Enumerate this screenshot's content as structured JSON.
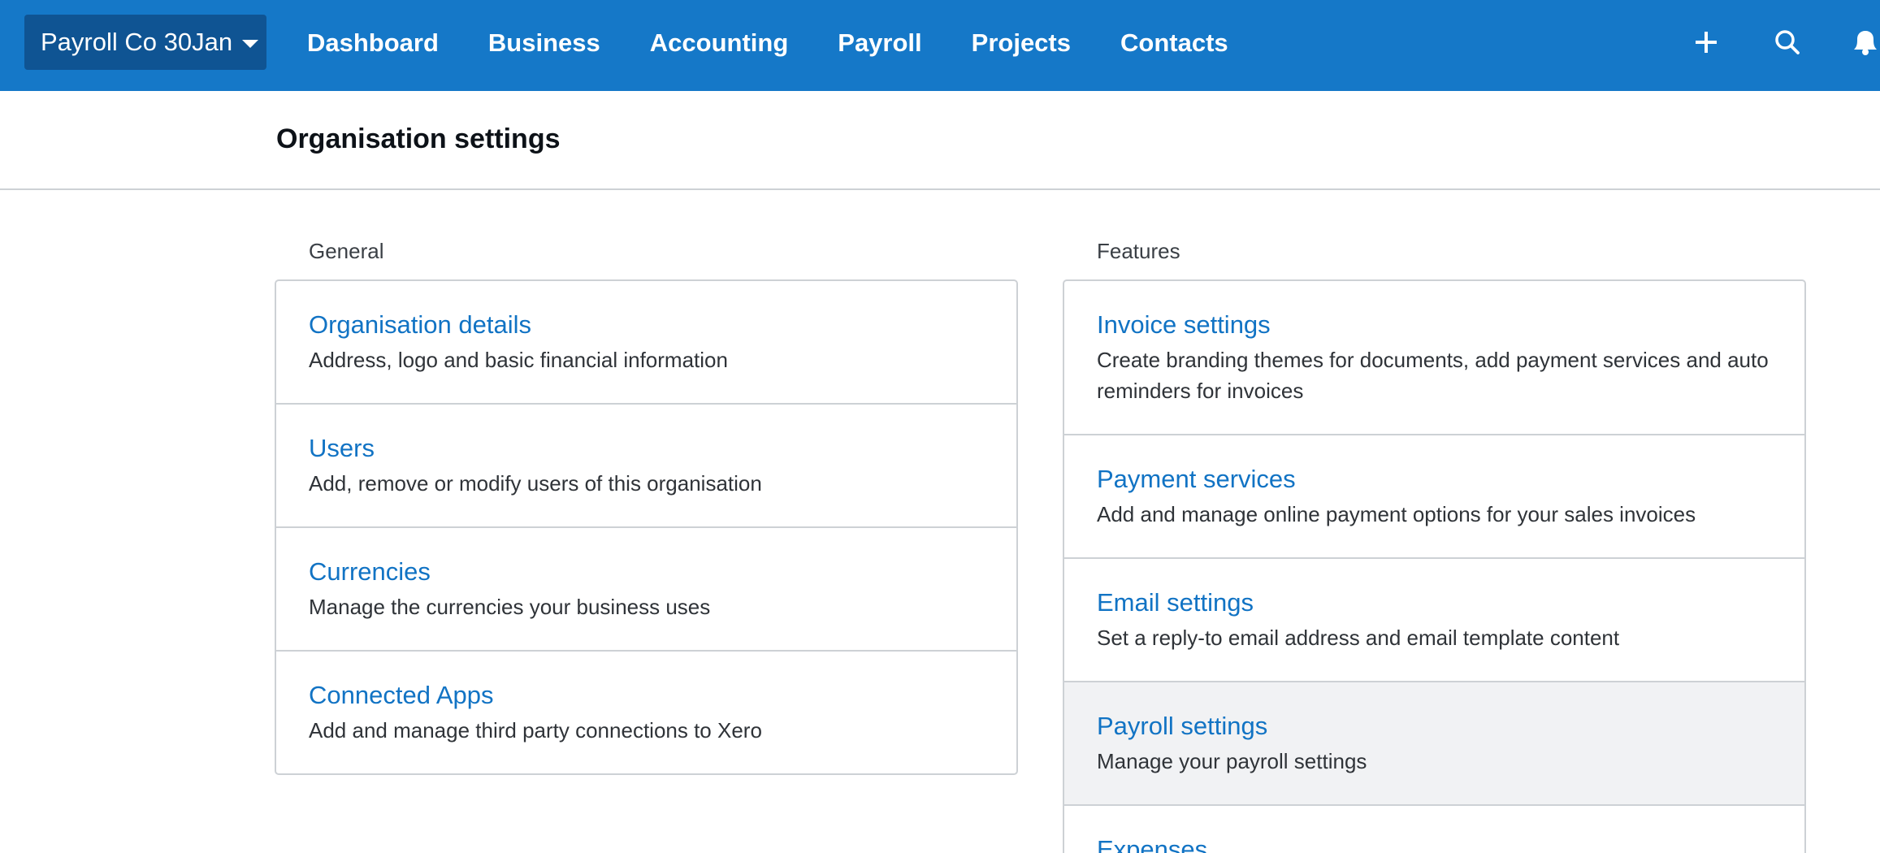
{
  "topbar": {
    "org_name": "Payroll Co 30Jan",
    "nav": [
      "Dashboard",
      "Business",
      "Accounting",
      "Payroll",
      "Projects",
      "Contacts"
    ],
    "icons": [
      "plus-icon",
      "search-icon",
      "bell-icon"
    ],
    "bg_color": "#1578c8",
    "org_switcher_color": "#0f5493"
  },
  "page": {
    "title": "Organisation settings"
  },
  "general": {
    "label": "General",
    "items": [
      {
        "title": "Organisation details",
        "desc": "Address, logo and basic financial information"
      },
      {
        "title": "Users",
        "desc": "Add, remove or modify users of this organisation"
      },
      {
        "title": "Currencies",
        "desc": "Manage the currencies your business uses"
      },
      {
        "title": "Connected Apps",
        "desc": "Add and manage third party connections to Xero"
      }
    ]
  },
  "features": {
    "label": "Features",
    "items": [
      {
        "title": "Invoice settings",
        "desc": "Create branding themes for documents, add payment services and auto reminders for invoices"
      },
      {
        "title": "Payment services",
        "desc": "Add and manage online payment options for your sales invoices"
      },
      {
        "title": "Email settings",
        "desc": "Set a reply-to email address and email template content"
      },
      {
        "title": "Payroll settings",
        "desc": "Manage your payroll settings",
        "highlighted": true
      },
      {
        "title": "Expenses",
        "desc": ""
      }
    ]
  },
  "colors": {
    "link": "#1173c4",
    "highlight_row": "#f1f2f4",
    "border": "#cdd1d5"
  }
}
